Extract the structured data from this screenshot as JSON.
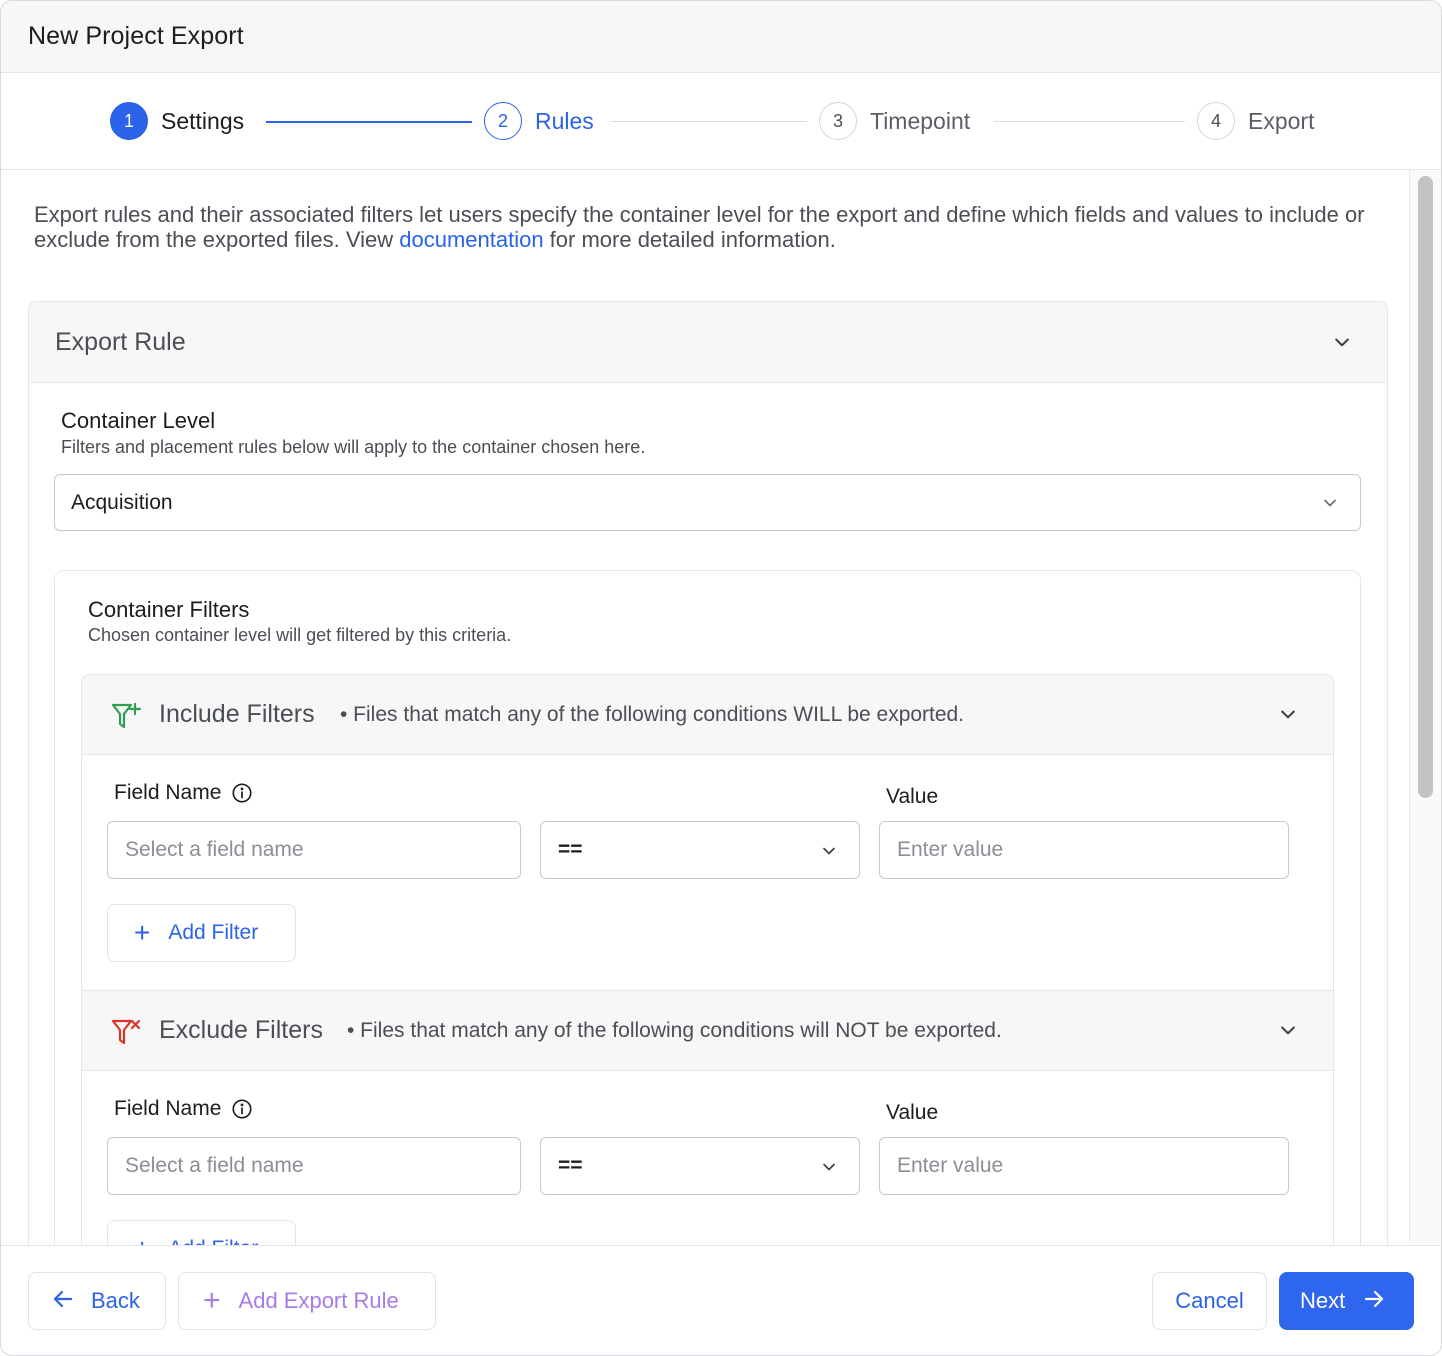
{
  "dialog": {
    "title": "New Project Export"
  },
  "stepper": {
    "steps": [
      {
        "number": "1",
        "label": "Settings",
        "state": "done"
      },
      {
        "number": "2",
        "label": "Rules",
        "state": "active"
      },
      {
        "number": "3",
        "label": "Timepoint",
        "state": "pending"
      },
      {
        "number": "4",
        "label": "Export",
        "state": "pending"
      }
    ]
  },
  "intro": {
    "text_before": "Export rules and their associated filters let users specify the container level for the export and define which fields and values to include or exclude from the exported files. View ",
    "link_text": "documentation",
    "text_after": " for more detailed information."
  },
  "export_rule": {
    "title": "Export Rule",
    "container_level": {
      "title": "Container Level",
      "subtitle": "Filters and placement rules below will apply to the container chosen here.",
      "selected": "Acquisition"
    },
    "container_filters": {
      "title": "Container Filters",
      "subtitle": "Chosen container level will get filtered by this criteria.",
      "include": {
        "title": "Include Filters",
        "description": "• Files that match any of the following conditions WILL be exported.",
        "field_label": "Field Name",
        "value_label": "Value",
        "field_placeholder": "Select a field name",
        "operator": "==",
        "value_placeholder": "Enter value",
        "add_filter_label": "Add Filter"
      },
      "exclude": {
        "title": "Exclude Filters",
        "description": "• Files that match any of the following conditions will NOT be exported.",
        "field_label": "Field Name",
        "value_label": "Value",
        "field_placeholder": "Select a field name",
        "operator": "==",
        "value_placeholder": "Enter value",
        "add_filter_label": "Add Filter"
      }
    }
  },
  "footer": {
    "back_label": "Back",
    "add_rule_label": "Add Export Rule",
    "cancel_label": "Cancel",
    "next_label": "Next"
  },
  "colors": {
    "accent": "#2b63e8",
    "include_icon": "#2e9e4f",
    "exclude_icon": "#d9342b",
    "add_rule_text": "#a77be6"
  },
  "icons": {
    "include": "filter-plus-icon",
    "exclude": "filter-x-icon",
    "info": "info-icon",
    "chevron": "chevron-down-icon",
    "back": "arrow-left-icon",
    "next": "arrow-right-icon",
    "add": "plus-icon"
  }
}
